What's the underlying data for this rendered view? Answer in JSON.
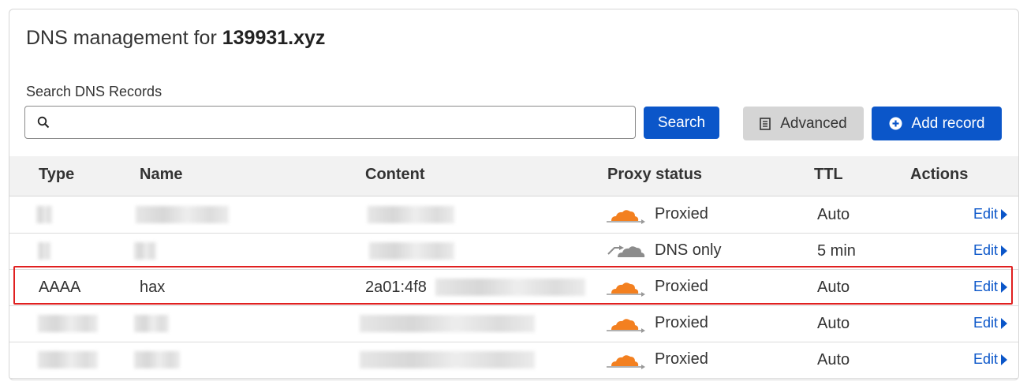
{
  "header": {
    "title_prefix": "DNS management for",
    "domain": "139931.xyz"
  },
  "search": {
    "label": "Search DNS Records",
    "value": "",
    "placeholder": "",
    "button_label": "Search"
  },
  "toolbar": {
    "advanced_label": "Advanced",
    "add_record_label": "Add record"
  },
  "table": {
    "columns": [
      "Type",
      "Name",
      "Content",
      "Proxy status",
      "TTL",
      "Actions"
    ],
    "rows": [
      {
        "type": "",
        "name": "",
        "content": "",
        "proxy_status": "Proxied",
        "ttl": "Auto",
        "action": "Edit"
      },
      {
        "type": "",
        "name": "",
        "content": "",
        "proxy_status": "DNS only",
        "ttl": "5 min",
        "action": "Edit"
      },
      {
        "type": "AAAA",
        "name": "hax",
        "content": "2a01:4f8",
        "proxy_status": "Proxied",
        "ttl": "Auto",
        "action": "Edit"
      },
      {
        "type": "",
        "name": "",
        "content": "",
        "proxy_status": "Proxied",
        "ttl": "Auto",
        "action": "Edit"
      },
      {
        "type": "",
        "name": "",
        "content": "",
        "proxy_status": "Proxied",
        "ttl": "Auto",
        "action": "Edit"
      }
    ]
  },
  "colors": {
    "primary": "#0b56c9",
    "proxied_cloud": "#f38020",
    "dns_only_cloud": "#8c8c8c",
    "highlight": "#e02020"
  }
}
